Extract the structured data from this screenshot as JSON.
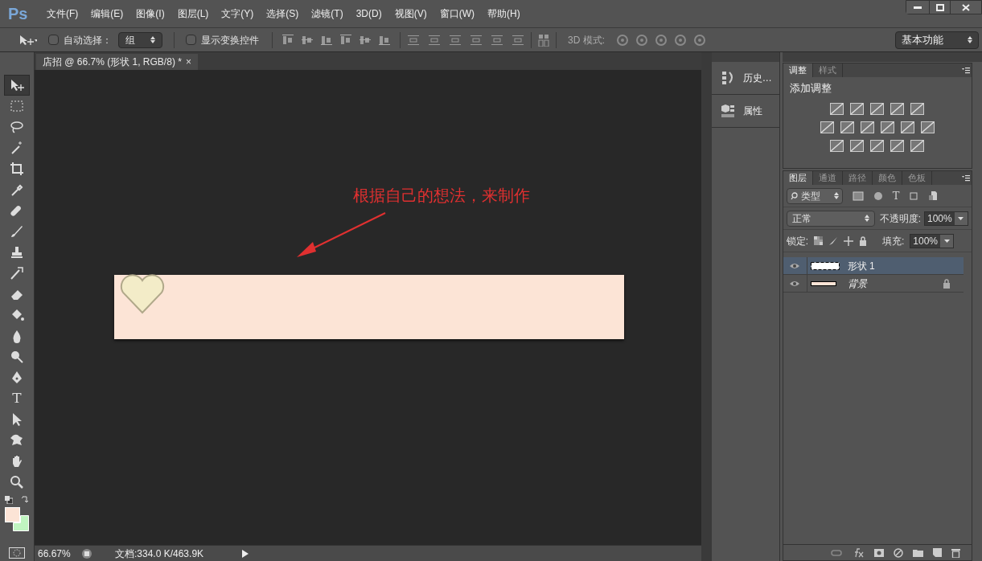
{
  "app": {
    "logo": "Ps"
  },
  "menu": [
    "文件(F)",
    "编辑(E)",
    "图像(I)",
    "图层(L)",
    "文字(Y)",
    "选择(S)",
    "滤镜(T)",
    "3D(D)",
    "视图(V)",
    "窗口(W)",
    "帮助(H)"
  ],
  "options_bar": {
    "auto_select": {
      "label": "自动选择：",
      "checked": false
    },
    "target": "组",
    "show_transform": {
      "label": "显示变换控件",
      "checked": false
    },
    "mode_3d_label": "3D 模式:",
    "workspace": "基本功能"
  },
  "tools": [
    {
      "kind": "move",
      "selected": true
    },
    {
      "kind": "marquee",
      "selected": false
    },
    {
      "kind": "lasso",
      "selected": false
    },
    {
      "kind": "wand",
      "selected": false
    },
    {
      "kind": "crop",
      "selected": false
    },
    {
      "kind": "eyedropper",
      "selected": false
    },
    {
      "kind": "healing",
      "selected": false
    },
    {
      "kind": "brush",
      "selected": false
    },
    {
      "kind": "stamp",
      "selected": false
    },
    {
      "kind": "history",
      "selected": false
    },
    {
      "kind": "eraser",
      "selected": false
    },
    {
      "kind": "bucket",
      "selected": false
    },
    {
      "kind": "blur",
      "selected": false
    },
    {
      "kind": "dodge",
      "selected": false
    },
    {
      "kind": "pen",
      "selected": false
    },
    {
      "kind": "type",
      "selected": false,
      "glyph": "T"
    },
    {
      "kind": "path",
      "selected": false
    },
    {
      "kind": "shape",
      "selected": false
    },
    {
      "kind": "hand",
      "selected": false
    },
    {
      "kind": "zoom",
      "selected": false
    }
  ],
  "document": {
    "tab": "店招 @ 66.7% (形状 1, RGB/8) *",
    "close": "×",
    "annotation": "根据自己的想法，来制作"
  },
  "status_bar": {
    "zoom": "66.67%",
    "info": "文档:334.0 K/463.9K"
  },
  "collapsed_panels": [
    {
      "kind": "history",
      "label": "历史…"
    },
    {
      "kind": "properties",
      "label": "属性"
    }
  ],
  "adjustments_panel": {
    "tabs": [
      {
        "label": "调整",
        "selected": true
      },
      {
        "label": "样式",
        "selected": false
      }
    ],
    "title": "添加调整"
  },
  "layers_panel": {
    "tabs": [
      {
        "label": "图层",
        "selected": true
      },
      {
        "label": "通道",
        "selected": false
      },
      {
        "label": "路径",
        "selected": false
      },
      {
        "label": "颜色",
        "selected": false
      },
      {
        "label": "色板",
        "selected": false
      }
    ],
    "filter": "类型",
    "type_filter_glyph": "T",
    "blend_mode": "正常",
    "opacity_label": "不透明度:",
    "opacity": "100%",
    "lock_label": "锁定:",
    "fill_label": "填充:",
    "fill": "100%",
    "layers": [
      {
        "kind": "shape",
        "name": "形状 1",
        "selected": true,
        "visible": true,
        "locked": false
      },
      {
        "kind": "background",
        "name": "背景",
        "selected": false,
        "visible": true,
        "locked": true
      }
    ]
  }
}
